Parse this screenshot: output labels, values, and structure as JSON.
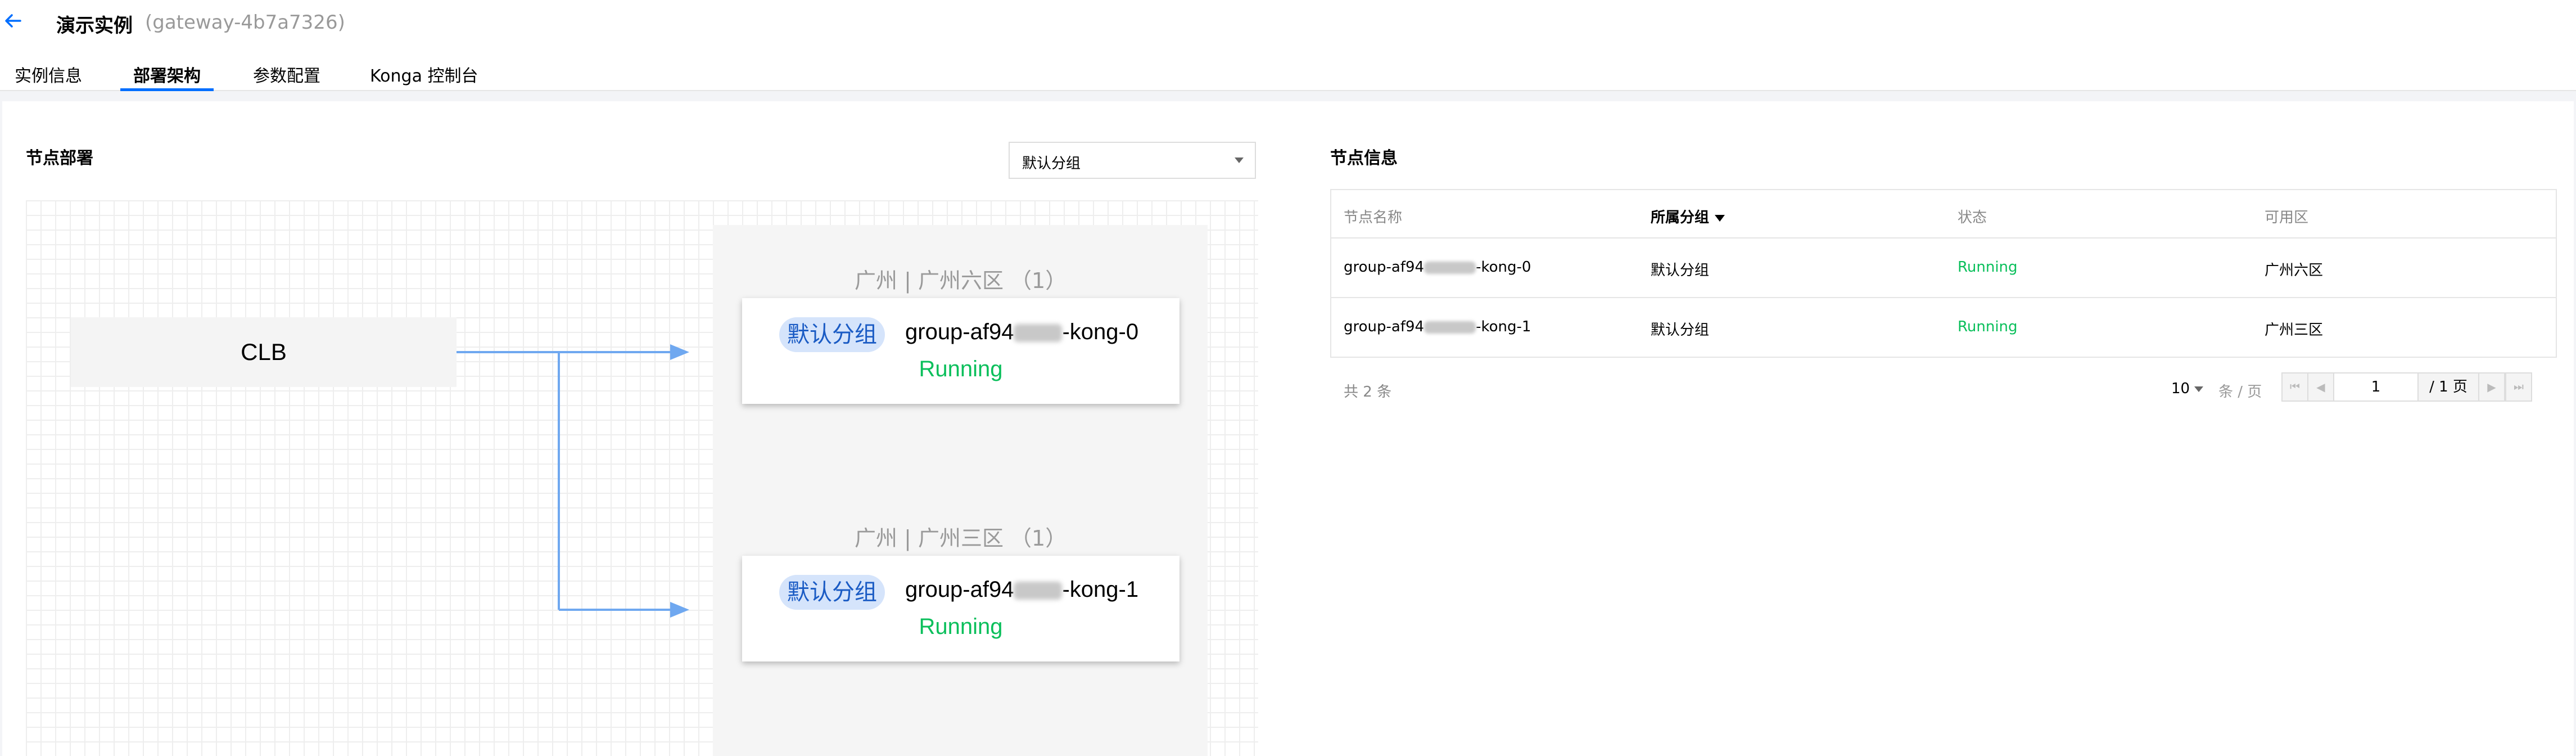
{
  "header": {
    "title": "演示实例",
    "instance_id": "(gateway-4b7a7326)",
    "tabs": [
      {
        "label": "实例信息",
        "active": false
      },
      {
        "label": "部署架构",
        "active": true
      },
      {
        "label": "参数配置",
        "active": false
      },
      {
        "label": "Konga 控制台",
        "active": false
      }
    ]
  },
  "deployment": {
    "title": "节点部署",
    "group_select": {
      "value": "默认分组"
    },
    "lb_label": "CLB",
    "zones": [
      {
        "label": "广州 | 广州六区 （1）",
        "node": {
          "tag": "默认分组",
          "name_prefix": "group-af94",
          "name_suffix": "-kong-0",
          "status": "Running"
        }
      },
      {
        "label": "广州 | 广州三区 （1）",
        "node": {
          "tag": "默认分组",
          "name_prefix": "group-af94",
          "name_suffix": "-kong-1",
          "status": "Running"
        }
      }
    ]
  },
  "node_info": {
    "title": "节点信息",
    "columns": [
      "节点名称",
      "所属分组",
      "状态",
      "可用区"
    ],
    "rows": [
      {
        "name_prefix": "group-af94",
        "name_suffix": "-kong-0",
        "group": "默认分组",
        "status": "Running",
        "zone": "广州六区"
      },
      {
        "name_prefix": "group-af94",
        "name_suffix": "-kong-1",
        "group": "默认分组",
        "status": "Running",
        "zone": "广州三区"
      }
    ],
    "pagination": {
      "total_text": "共 2 条",
      "page_size": "10",
      "per_page_text": "条 / 页",
      "current_page": "1",
      "total_pages_text": "/ 1 页"
    }
  },
  "colors": {
    "accent": "#006eff",
    "running": "#0abf5b",
    "arrow": "#6fa8f0"
  }
}
